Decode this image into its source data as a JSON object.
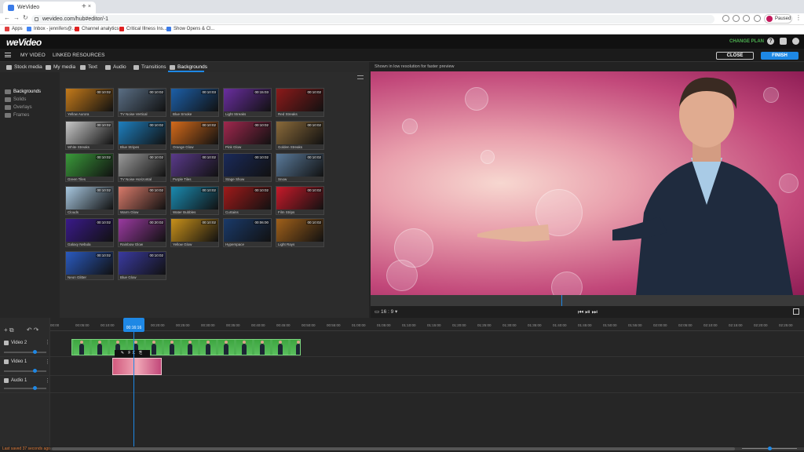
{
  "browser": {
    "tab_title": "WeVideo",
    "url": "wevideo.com/hub#editor/-1",
    "profile_status": "Paused",
    "bookmarks": [
      "Apps",
      "Inbox - jennifers@...",
      "Channel analytics",
      "Critical Illness Ins...",
      "Show Opens & Cl..."
    ]
  },
  "app": {
    "logo": "weVideo",
    "change_plan": "CHANGE PLAN",
    "menu": {
      "my_video": "MY VIDEO",
      "linked_resources": "LINKED RESOURCES"
    },
    "close_label": "CLOSE",
    "finish_label": "FINISH"
  },
  "media_tabs": [
    "Stock media",
    "My media",
    "Text",
    "Audio",
    "Transitions",
    "Backgrounds"
  ],
  "active_media_tab": "Backgrounds",
  "categories": [
    "Backgrounds",
    "Solids",
    "Overlays",
    "Frames"
  ],
  "selected_category": "Backgrounds",
  "backgrounds": [
    {
      "name": "Yellow Aurora",
      "duration": "00:10:02",
      "color": "#c47a1a"
    },
    {
      "name": "TV Noise Vertical",
      "duration": "00:10:02",
      "color": "#5a6e84"
    },
    {
      "name": "Blue Smoke",
      "duration": "00:10:03",
      "color": "#1c5fa8"
    },
    {
      "name": "Light Streaks",
      "duration": "00:15:03",
      "color": "#6a2ea0"
    },
    {
      "name": "Red Streaks",
      "duration": "00:10:02",
      "color": "#8c1a1a"
    },
    {
      "name": "White Streaks",
      "duration": "00:10:02",
      "color": "#c8c8c8"
    },
    {
      "name": "Blue Stripes",
      "duration": "00:10:02",
      "color": "#1e7fbf"
    },
    {
      "name": "Orange Glow",
      "duration": "00:10:02",
      "color": "#d46a1a"
    },
    {
      "name": "Pink Glow",
      "duration": "00:10:02",
      "color": "#a0284e"
    },
    {
      "name": "Golden Streaks",
      "duration": "00:10:02",
      "color": "#8a6a3a"
    },
    {
      "name": "Green Tiles",
      "duration": "00:10:02",
      "color": "#3a9a3a"
    },
    {
      "name": "TV Noise Horizontal",
      "duration": "00:10:02",
      "color": "#9a9a9a"
    },
    {
      "name": "Purple Tiles",
      "duration": "00:10:02",
      "color": "#5a3a8a"
    },
    {
      "name": "Stage Show",
      "duration": "00:10:02",
      "color": "#1a2a5a"
    },
    {
      "name": "Snow",
      "duration": "00:10:02",
      "color": "#5a7a9a"
    },
    {
      "name": "Clouds",
      "duration": "00:10:02",
      "color": "#a8c8e0"
    },
    {
      "name": "Warm Glow",
      "duration": "00:10:02",
      "color": "#d87a6a"
    },
    {
      "name": "Water Bubbles",
      "duration": "00:10:02",
      "color": "#1a8ab0"
    },
    {
      "name": "Curtains",
      "duration": "00:10:02",
      "color": "#a01a1a"
    },
    {
      "name": "Film Strips",
      "duration": "00:10:02",
      "color": "#c81a2a"
    },
    {
      "name": "Galaxy Nebula",
      "duration": "00:10:02",
      "color": "#3a1a8a"
    },
    {
      "name": "Rainbow Glow",
      "duration": "00:20:02",
      "color": "#9a3aa0"
    },
    {
      "name": "Yellow Glow",
      "duration": "00:10:02",
      "color": "#c8901a"
    },
    {
      "name": "Hyperspace",
      "duration": "00:06:00",
      "color": "#1a3a6a"
    },
    {
      "name": "Light Rays",
      "duration": "00:10:02",
      "color": "#a0601a"
    },
    {
      "name": "Neon Glitter",
      "duration": "00:10:02",
      "color": "#2a5ac0"
    },
    {
      "name": "Blue Glow",
      "duration": "00:10:02",
      "color": "#3a3aa0"
    }
  ],
  "preview": {
    "note": "Shown in low resolution for faster preview",
    "aspect": "16 : 9",
    "playhead_progress": 0.44
  },
  "timeline": {
    "ticks": [
      "00:00",
      "00:05:00",
      "00:10:00",
      "00:15:00",
      "00:20:00",
      "00:25:00",
      "00:30:00",
      "00:35:00",
      "00:40:00",
      "00:45:00",
      "00:50:00",
      "00:55:00",
      "01:00:00",
      "01:05:00",
      "01:10:00",
      "01:15:00",
      "01:20:00",
      "01:25:00",
      "01:30:00",
      "01:35:00",
      "01:40:00",
      "01:45:00",
      "01:50:00",
      "01:55:00",
      "02:00:00",
      "02:05:00",
      "02:10:00",
      "02:15:00",
      "02:20:00",
      "02:25:00"
    ],
    "playhead_time": "00:16:16",
    "tracks": [
      "Video 2",
      "Video 1",
      "Audio 1"
    ],
    "fx_label": "FX",
    "last_saved": "Last saved 37 seconds ago"
  },
  "icons": {
    "tab_favicon": "wevideo-icon",
    "help": "help-icon",
    "notifications": "bell-icon",
    "upgrade": "rocket-icon"
  }
}
